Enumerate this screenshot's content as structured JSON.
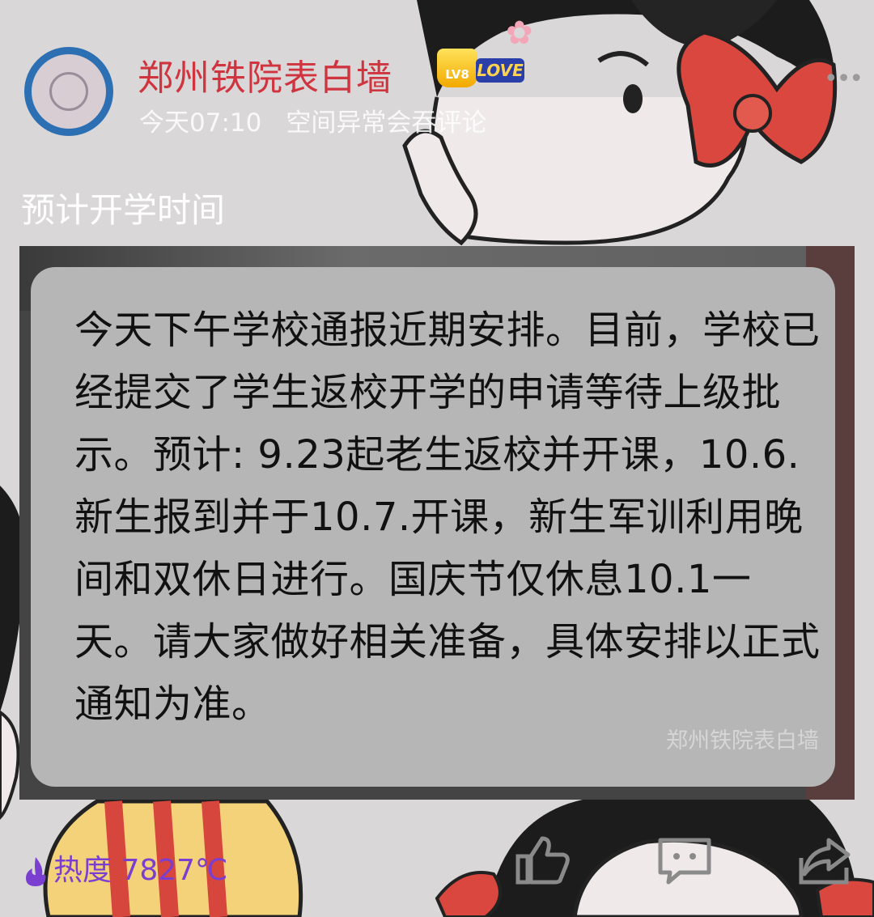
{
  "post": {
    "account_name": "郑州铁院表白墙",
    "vip_level": "LV8",
    "vip_badge_text": "LOVE",
    "time": "今天07:10",
    "notice": "空间异常会吞评论",
    "text": "预计开学时间"
  },
  "image": {
    "message": "今天下午学校通报近期安排。目前，学校已经提交了学生返校开学的申请等待上级批示。预计: 9.23起老生返校并开课，10.6.新生报到并于10.7.开课，新生军训利用晚间和双休日进行。国庆节仅休息10.1一天。请大家做好相关准备，具体安排以正式通知为准。",
    "watermark": "郑州铁院表白墙"
  },
  "footer": {
    "heat_label": "热度 7827℃"
  },
  "icons": {
    "more": "more-icon",
    "like": "thumbs-up-icon",
    "comment": "comment-icon",
    "share": "share-icon",
    "heat": "flame-icon"
  },
  "colors": {
    "account_name": "#d0343f",
    "heat": "#7a3fd0",
    "avatar_ring": "#2d6fb3"
  }
}
